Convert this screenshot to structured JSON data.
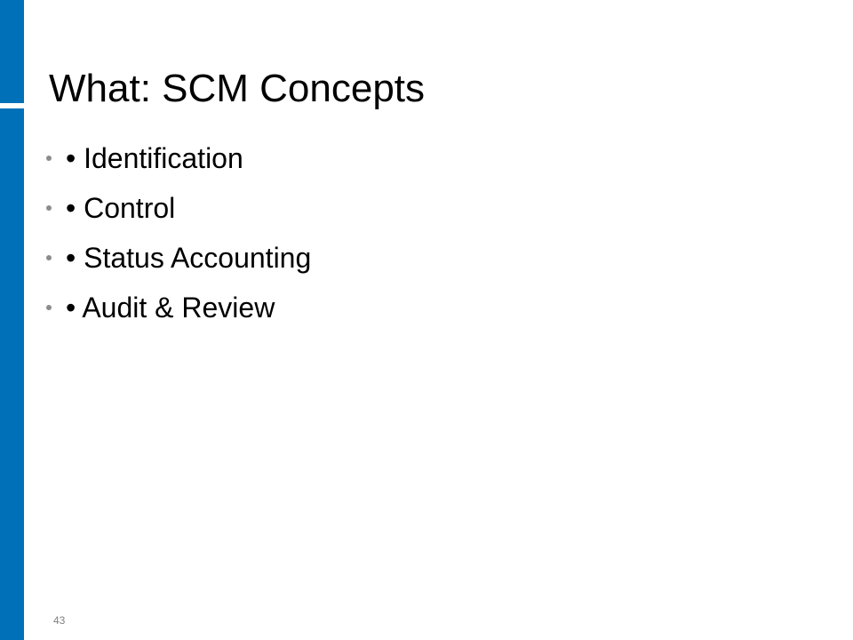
{
  "slide": {
    "title": "What: SCM Concepts",
    "bullets": [
      "• Identification",
      "• Control",
      "• Status Accounting",
      "• Audit & Review"
    ],
    "page_number": "43"
  },
  "colors": {
    "accent": "#0070b8",
    "bullet_marker": "#8c8c8c",
    "page_number": "#808080"
  }
}
